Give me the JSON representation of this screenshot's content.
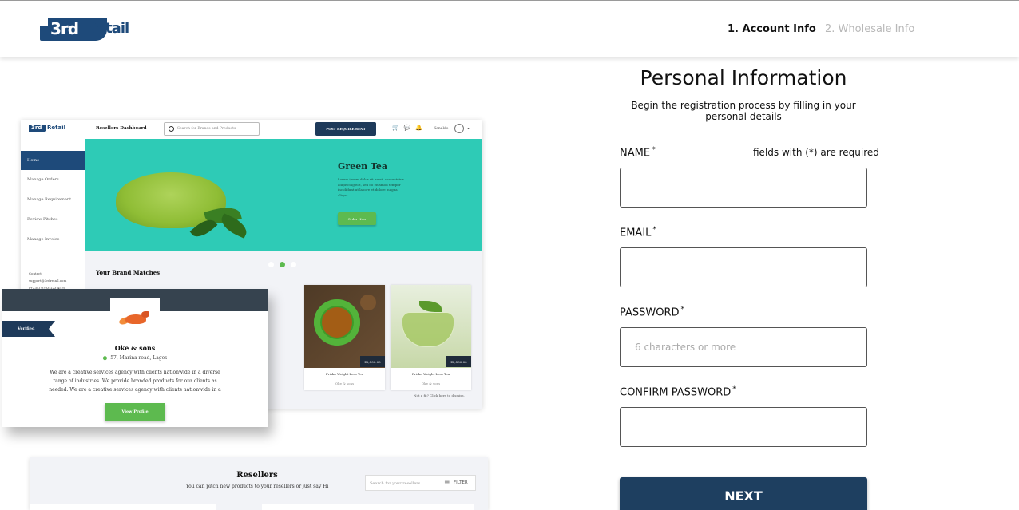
{
  "header": {
    "logo_num": "3rd",
    "logo_word": "Retail",
    "steps": [
      {
        "label": "1. Account Info",
        "active": true
      },
      {
        "label": "2. Wholesale Info",
        "active": false
      }
    ]
  },
  "preview": {
    "logo_num": "3rd",
    "logo_word": "Retail",
    "dashboard_title": "Resellers Dashboard",
    "search_placeholder": "Search for Brands and Products",
    "post_button": "POST REQUIREMENT",
    "user_name": "Kenaldo",
    "nav": [
      "Home",
      "Manage Orders",
      "Manage Requirement",
      "Review Pitches",
      "Manage Invoice"
    ],
    "contact": {
      "title": "Contact",
      "email": "support@3rdretail.com",
      "phone": "(+234) 0703 123 4576"
    },
    "banner": {
      "title": "Green Tea",
      "body": "Lorem ipsum dolor sit amet, consectetur adipiscing elit, sed do eiusmod tempor incididunt ut labore et dolore magna aliqua.",
      "button": "Order Now"
    },
    "brand_matches_title": "Your Brand Matches",
    "products": [
      {
        "name": "Frisko Weight Loss Tea",
        "brand": "Oke & sons",
        "price": "₦2,500.00"
      },
      {
        "name": "Frisko Weight Loss Tea",
        "brand": "Oke & sons",
        "price": "₦2,500.00"
      }
    ],
    "not_fit": "Not a fit? Click here to dismiss."
  },
  "vendor_card": {
    "badge": "Verified",
    "name": "Oke & sons",
    "address": "57, Marina road, Lagos",
    "description": "We are a creative services agency with clients nationwide in a diverse range of industries. We provide branded products for our clients as needed. We are a creative services agency with clients nationwide in a",
    "button": "View Profile"
  },
  "resellers": {
    "title": "Resellers",
    "subtitle": "You can pitch new products to your resellers or just say Hi",
    "search_placeholder": "Search for your resellers",
    "filter": "FILTER"
  },
  "form": {
    "title": "Personal Information",
    "subtitle": "Begin the registration process by filling in your personal details",
    "required_note": "fields with (*) are required",
    "fields": [
      {
        "label": "NAME",
        "value": "",
        "placeholder": ""
      },
      {
        "label": "EMAIL",
        "value": "",
        "placeholder": ""
      },
      {
        "label": "PASSWORD",
        "value": "",
        "placeholder": "6 characters or more"
      },
      {
        "label": "CONFIRM PASSWORD",
        "value": "",
        "placeholder": ""
      }
    ],
    "asterisk": "*",
    "next_button": "NEXT"
  }
}
